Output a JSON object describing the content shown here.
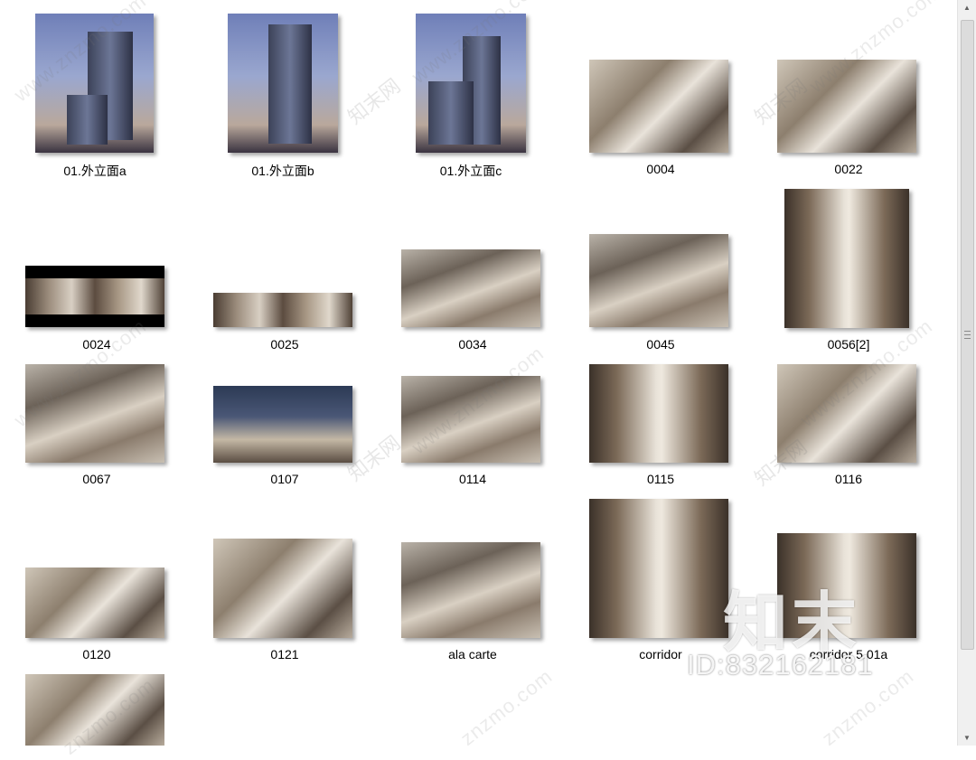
{
  "files": [
    {
      "label": "01.外立面a"
    },
    {
      "label": "01.外立面b"
    },
    {
      "label": "01.外立面c"
    },
    {
      "label": "0004"
    },
    {
      "label": "0022"
    },
    {
      "label": "0024"
    },
    {
      "label": "0025"
    },
    {
      "label": "0034"
    },
    {
      "label": "0045"
    },
    {
      "label": "0056[2]"
    },
    {
      "label": "0067"
    },
    {
      "label": "0107"
    },
    {
      "label": "0114"
    },
    {
      "label": "0115"
    },
    {
      "label": "0116"
    },
    {
      "label": "0120"
    },
    {
      "label": "0121"
    },
    {
      "label": "ala carte"
    },
    {
      "label": "corridor"
    },
    {
      "label": "corridor 5.01a"
    },
    {
      "label": ""
    }
  ],
  "watermark": {
    "brand": "知末",
    "id_text": "ID:832162181",
    "site_cn": "知末网",
    "site_url": "www.znzmo.com",
    "site_url_short": "znzmo.com"
  },
  "scrollbar": {
    "up_icon": "▲",
    "down_icon": "▼"
  }
}
